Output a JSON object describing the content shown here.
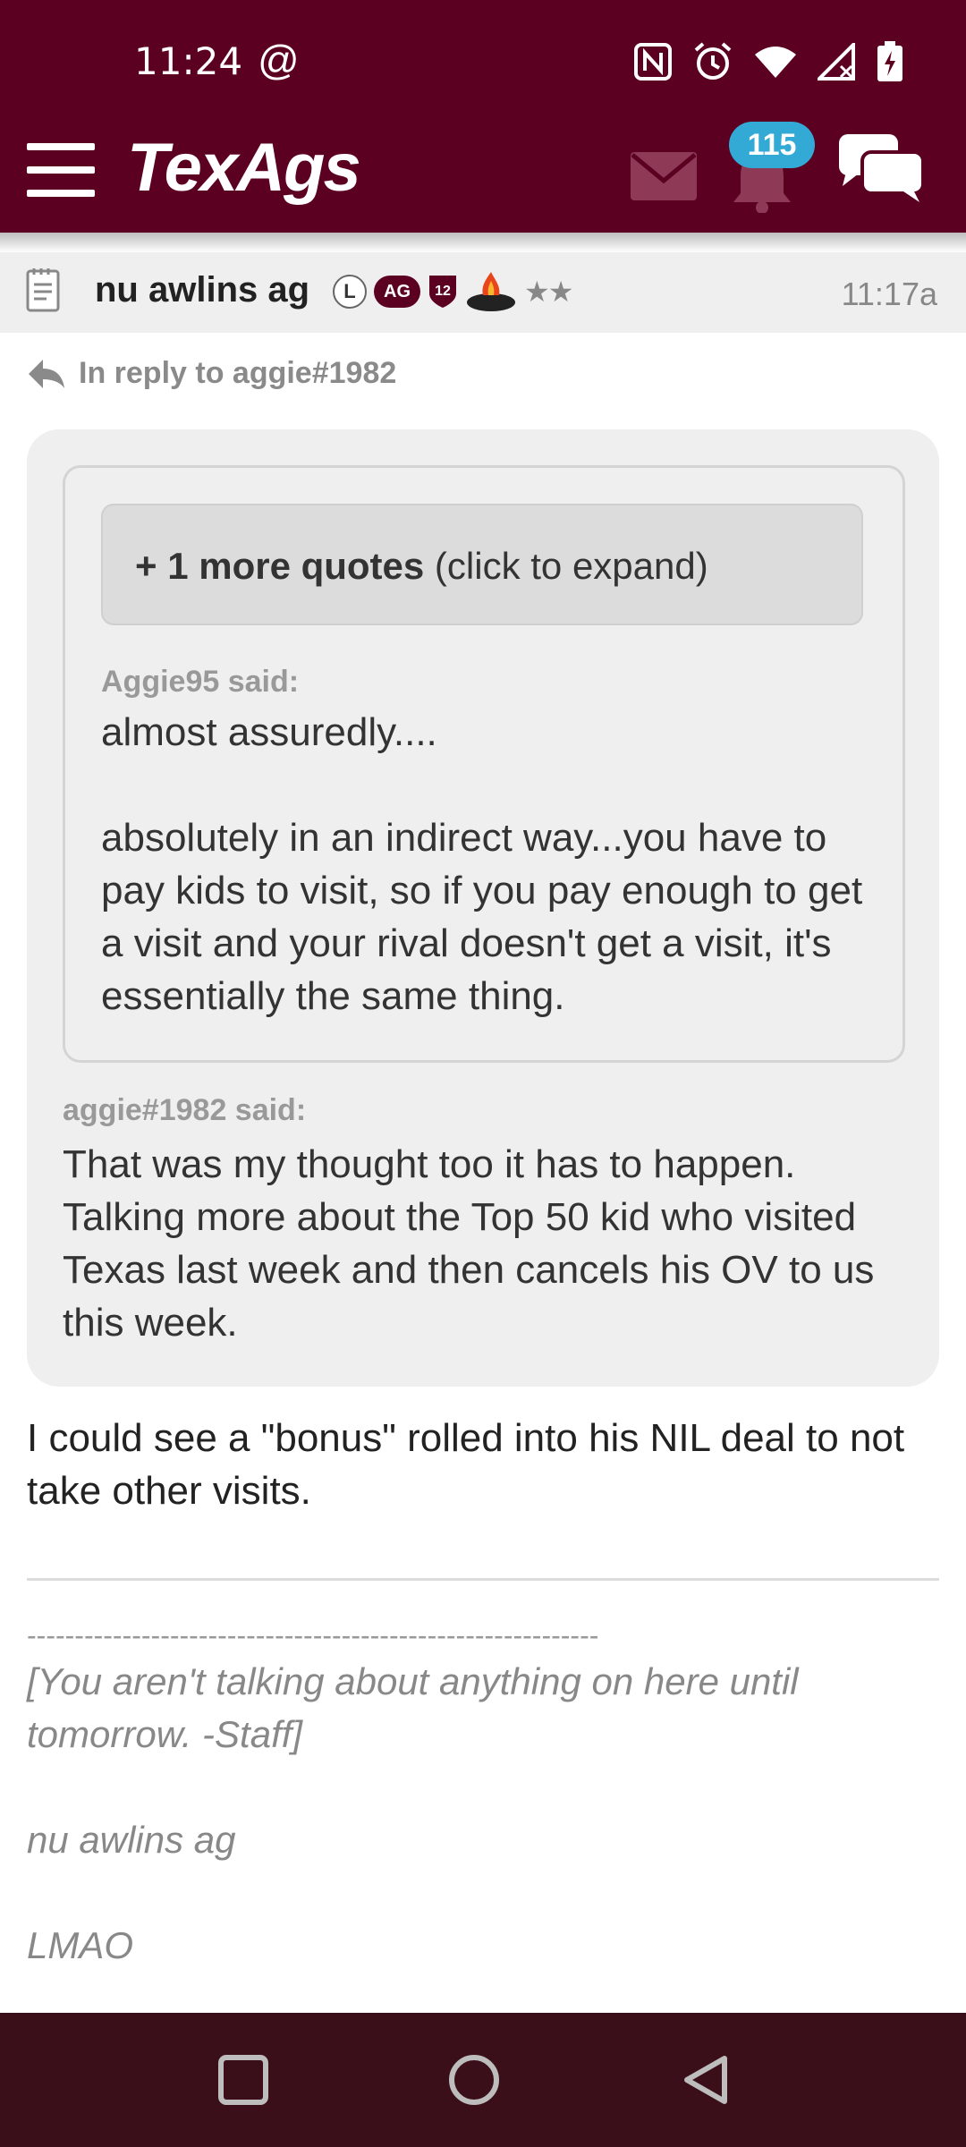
{
  "status_bar": {
    "time": "11:24",
    "at_symbol": "@",
    "icons": [
      "nfc-icon",
      "alarm-icon",
      "wifi-icon",
      "signal-icon",
      "battery-charging-icon"
    ]
  },
  "app_bar": {
    "logo": "TexAgs",
    "notification_count": "115",
    "icons": [
      "menu-icon",
      "mail-icon",
      "bell-icon",
      "chat-icon"
    ]
  },
  "post": {
    "username": "nu awlins ag",
    "badges": {
      "l": "L",
      "ag": "AG",
      "twelve": "12",
      "stars": "★★"
    },
    "time": "11:17a",
    "reply_to": "In reply to aggie#1982",
    "quote": {
      "expand_bold": "+ 1 more quotes",
      "expand_rest": " (click to expand)",
      "inner_author": "Aggie95 said:",
      "inner_line1": "almost assuredly....",
      "inner_line2": "absolutely in an indirect way...you have to pay kids to visit, so if you pay enough to get a visit and your rival doesn't get a visit, it's essentially the same thing.",
      "outer_author": "aggie#1982 said:",
      "outer_text": "That was my thought too it has to happen. Talking more about the Top 50 kid who visited Texas last week and then cancels his OV to us this week."
    },
    "body": "I could see a \"bonus\" rolled into his NIL deal to not take other visits.",
    "signature": {
      "dashes": "------------------------------------------------------------",
      "line1": "[You aren't talking about anything on here until tomorrow. -Staff]",
      "line2": "nu awlins ag",
      "line3": "LMAO"
    }
  },
  "colors": {
    "brand": "#5c0022",
    "badge": "#33a9d6",
    "navbar": "#3a0f19"
  },
  "nav_bar": {
    "icons": [
      "recents-square-icon",
      "home-circle-icon",
      "back-triangle-icon"
    ]
  }
}
